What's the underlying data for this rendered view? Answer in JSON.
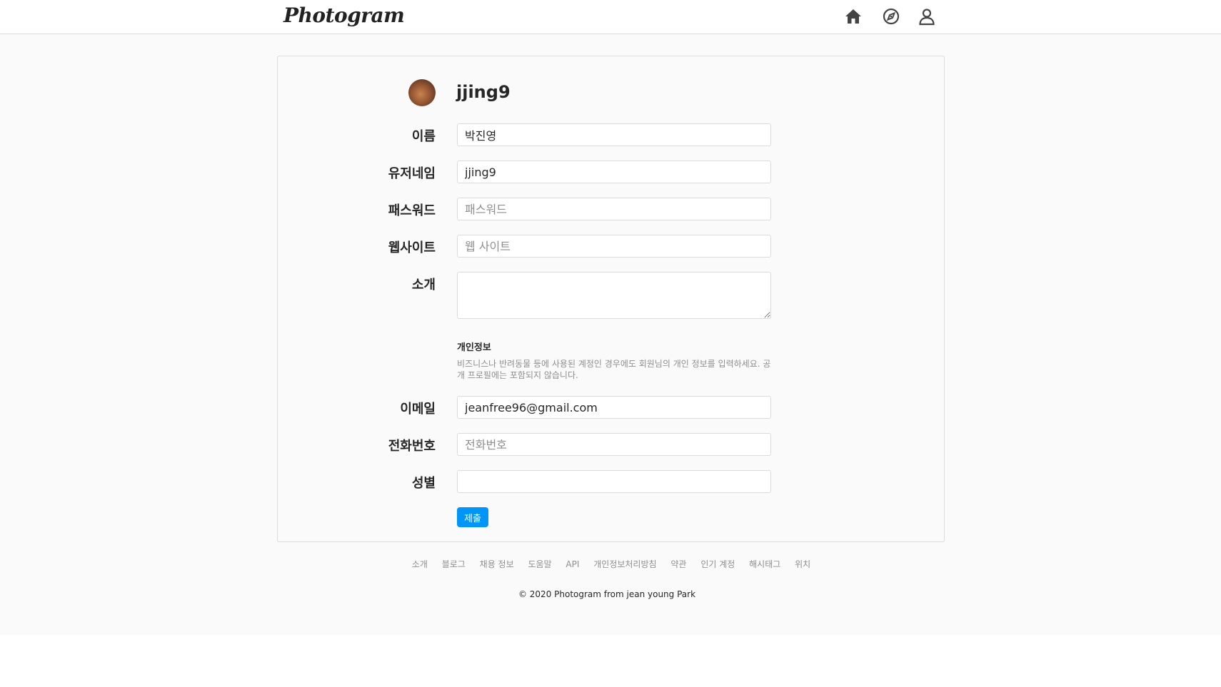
{
  "header": {
    "logo": "Photogram",
    "icons": [
      "home-icon",
      "explore-icon",
      "user-icon"
    ]
  },
  "profile": {
    "username": "jjing9"
  },
  "form": {
    "name": {
      "label": "이름",
      "value": "박진영",
      "placeholder": ""
    },
    "username": {
      "label": "유저네임",
      "value": "jjing9",
      "placeholder": ""
    },
    "password": {
      "label": "패스워드",
      "value": "",
      "placeholder": "패스워드"
    },
    "website": {
      "label": "웹사이트",
      "value": "",
      "placeholder": "웹 사이트"
    },
    "bio": {
      "label": "소개",
      "value": ""
    },
    "private_info": {
      "title": "개인정보",
      "description": "비즈니스나 반려동물 등에 사용된 계정인 경우에도 회원님의 개인 정보를 입력하세요. 공개 프로필에는 포함되지 않습니다."
    },
    "email": {
      "label": "이메일",
      "value": "jeanfree96@gmail.com",
      "placeholder": ""
    },
    "phone": {
      "label": "전화번호",
      "value": "",
      "placeholder": "전화번호"
    },
    "gender": {
      "label": "성별",
      "value": "",
      "placeholder": ""
    },
    "submit_label": "제출"
  },
  "footer": {
    "links": [
      "소개",
      "블로그",
      "채용 정보",
      "도움말",
      "API",
      "개인정보처리방침",
      "약관",
      "인기 계정",
      "해시태그",
      "위치"
    ],
    "copyright": "© 2020 Photogram from jean young Park"
  },
  "colors": {
    "accent": "#0095f6",
    "border": "#dbdbdb",
    "background": "#fafafa"
  }
}
